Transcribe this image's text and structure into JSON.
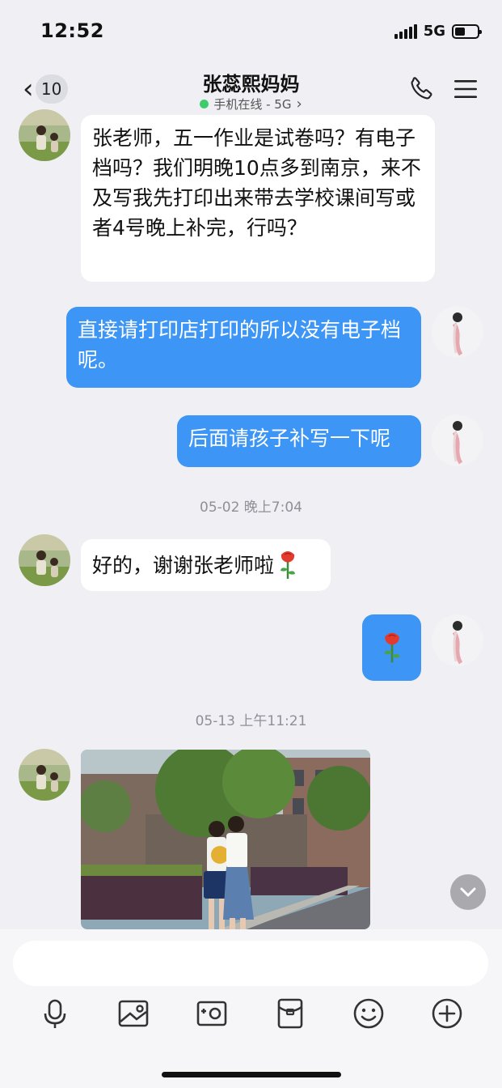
{
  "status_bar": {
    "time": "12:52",
    "network": "5G"
  },
  "header": {
    "back_count": "10",
    "title": "张蕊熙妈妈",
    "subtitle": "手机在线 - 5G",
    "subtitle_chevron": "›"
  },
  "messages": [
    {
      "side": "left",
      "text": "张老师，五一作业是试卷吗？有电子档吗？我们明晚10点多到南京，来不及写我先打印出来带去学校课间写或者4号晚上补完，行吗？"
    },
    {
      "side": "right",
      "text": "直接请打印店打印的所以没有电子档呢。"
    },
    {
      "side": "right",
      "text": "后面请孩子补写一下呢"
    },
    {
      "side": "left",
      "text": "好的，谢谢张老师啦",
      "emoji": "rose"
    },
    {
      "side": "right",
      "emoji": "rose"
    },
    {
      "side": "left",
      "type": "photo"
    }
  ],
  "timestamps": [
    "05-02 晚上7:04",
    "05-13 上午11:21"
  ],
  "toolbar": {
    "icons": [
      "microphone-icon",
      "image-icon",
      "camera-icon",
      "red-packet-icon",
      "emoji-icon",
      "plus-icon"
    ]
  },
  "colors": {
    "bubble_sent": "#3d96f5",
    "bubble_received": "#ffffff",
    "online_dot": "#3ccc6a",
    "background": "#efeff4"
  }
}
